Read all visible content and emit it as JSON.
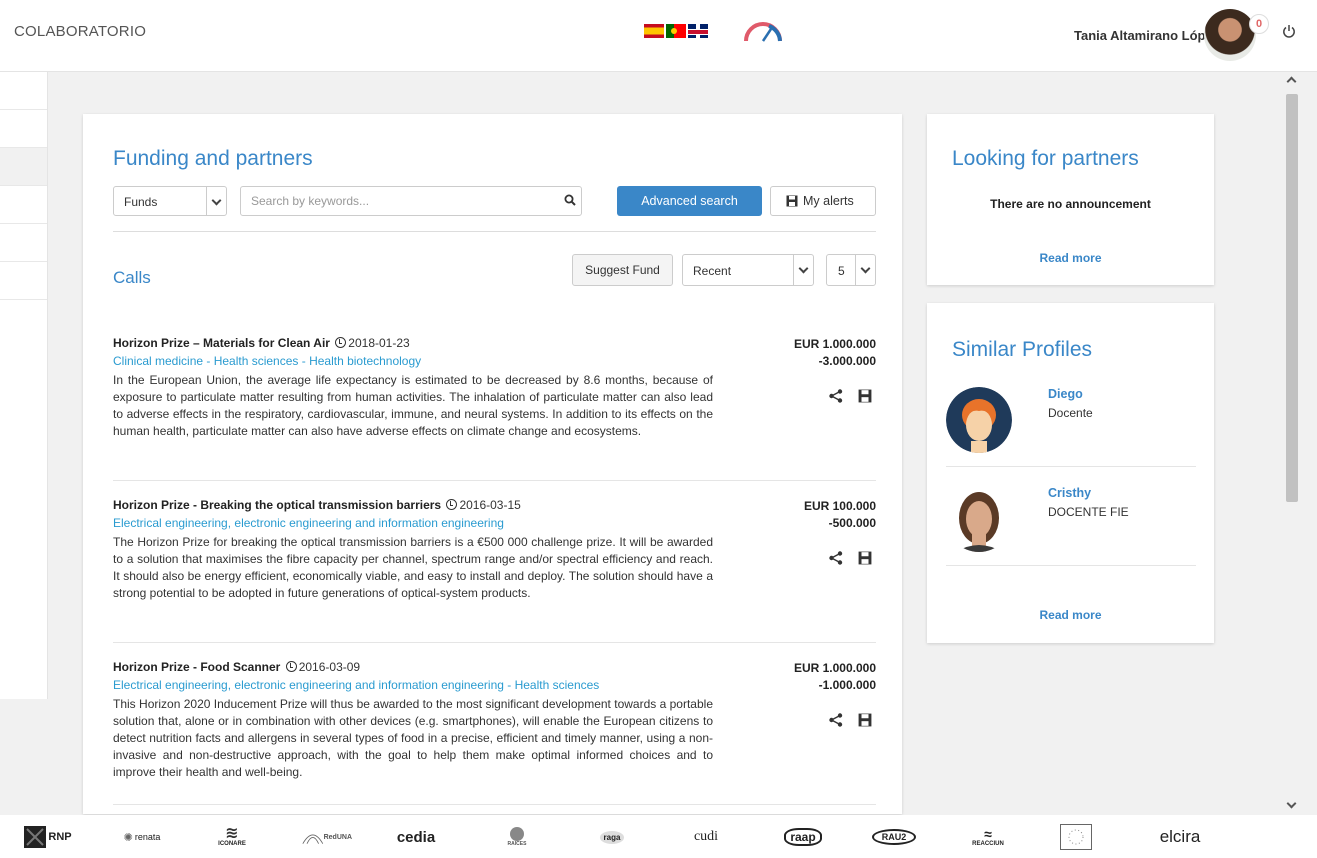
{
  "header": {
    "brand": "COLABORATORIO",
    "user_name": "Tania Altamirano Lóp...",
    "notifications": "0",
    "flags": [
      "spain-flag",
      "portugal-flag",
      "uk-flag"
    ]
  },
  "main": {
    "title": "Funding and partners",
    "type_select": "Funds",
    "search_placeholder": "Search by keywords...",
    "advanced_search": "Advanced search",
    "my_alerts": "My alerts",
    "calls_title": "Calls",
    "suggest_fund": "Suggest Fund",
    "sort_select": "Recent",
    "page_size_select": "5",
    "calls": [
      {
        "title": "Horizon Prize – Materials for Clean Air",
        "date": "2018-01-23",
        "area": "Clinical medicine - Health sciences - Health biotechnology",
        "description": "In the European Union, the average life expectancy is estimated to be decreased by 8.6 months, because of exposure to particulate matter resulting from human activities. The inhalation of particulate matter can also lead to adverse effects in the respiratory, cardiovascular, immune, and neural systems. In addition to its effects on the human health, particulate matter can also have adverse effects on climate change and ecosystems.",
        "amount_line1": "EUR 1.000.000",
        "amount_line2": "-3.000.000"
      },
      {
        "title": "Horizon Prize - Breaking the optical transmission barriers",
        "date": "2016-03-15",
        "area": "Electrical engineering, electronic engineering and information engineering",
        "description": "The Horizon Prize for breaking the optical transmission barriers is a €500 000 challenge prize. It will be awarded to a solution that maximises the fibre capacity per channel, spectrum range and/or spectral efficiency and reach. It should also be energy efficient, economically viable, and easy to install and deploy. The solution should have a strong potential to be adopted in future generations of optical-system products.",
        "amount_line1": "EUR 100.000",
        "amount_line2": "-500.000"
      },
      {
        "title": "Horizon Prize - Food Scanner",
        "date": "2016-03-09",
        "area": "Electrical engineering, electronic engineering and information engineering - Health sciences",
        "description": "This Horizon 2020 Inducement Prize will thus be awarded to the most significant development towards a portable solution that, alone or in combination with other devices (e.g. smartphones), will enable the European citizens to detect nutrition facts and allergens in several types of food in a precise, efficient and timely manner, using a non-invasive and non-destructive approach, with the goal to help them make optimal informed choices and to improve their health and well-being.",
        "amount_line1": "EUR 1.000.000",
        "amount_line2": "-1.000.000"
      }
    ]
  },
  "partners_panel": {
    "title": "Looking for partners",
    "note": "There are no announcement",
    "read_more": "Read more"
  },
  "profiles_panel": {
    "title": "Similar Profiles",
    "profiles": [
      {
        "name": "Diego",
        "role": "Docente"
      },
      {
        "name": "Cristhy",
        "role": "DOCENTE FIE"
      }
    ],
    "read_more": "Read more"
  },
  "footer": {
    "logos": [
      "RNP",
      "renata",
      "ICONARE",
      "RedUNA",
      "cedia",
      "RAICES",
      "raga",
      "cudi",
      "raap",
      "RAU2",
      "REACCIUN",
      "eu-flag",
      "elcira"
    ]
  },
  "colors": {
    "accent": "#3a87c8",
    "link": "#2a9bd0",
    "notification": "#e06666"
  }
}
